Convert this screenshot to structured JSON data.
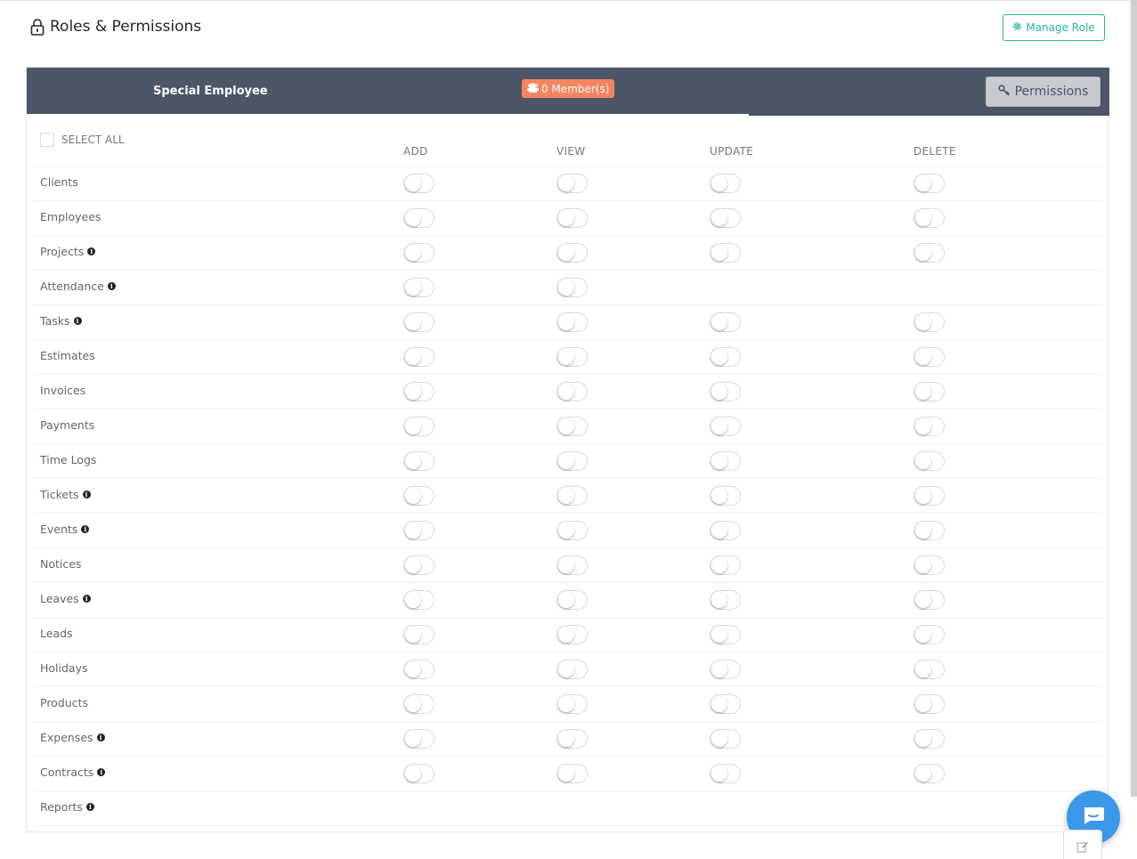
{
  "header": {
    "title": "Roles & Permissions",
    "manage_role_label": "Manage Role"
  },
  "role": {
    "name": "Special Employee",
    "members_label": "0 Member(s)",
    "permissions_button": "Permissions"
  },
  "table": {
    "select_all_label": "SELECT ALL",
    "columns": [
      "ADD",
      "VIEW",
      "UPDATE",
      "DELETE"
    ],
    "modules": [
      {
        "label": "Clients",
        "info": false,
        "toggles": [
          true,
          true,
          true,
          true
        ]
      },
      {
        "label": "Employees",
        "info": false,
        "toggles": [
          true,
          true,
          true,
          true
        ]
      },
      {
        "label": "Projects",
        "info": true,
        "toggles": [
          true,
          true,
          true,
          true
        ]
      },
      {
        "label": "Attendance",
        "info": true,
        "toggles": [
          true,
          true,
          false,
          false
        ]
      },
      {
        "label": "Tasks",
        "info": true,
        "toggles": [
          true,
          true,
          true,
          true
        ]
      },
      {
        "label": "Estimates",
        "info": false,
        "toggles": [
          true,
          true,
          true,
          true
        ]
      },
      {
        "label": "Invoices",
        "info": false,
        "toggles": [
          true,
          true,
          true,
          true
        ]
      },
      {
        "label": "Payments",
        "info": false,
        "toggles": [
          true,
          true,
          true,
          true
        ]
      },
      {
        "label": "Time Logs",
        "info": false,
        "toggles": [
          true,
          true,
          true,
          true
        ]
      },
      {
        "label": "Tickets",
        "info": true,
        "toggles": [
          true,
          true,
          true,
          true
        ]
      },
      {
        "label": "Events",
        "info": true,
        "toggles": [
          true,
          true,
          true,
          true
        ]
      },
      {
        "label": "Notices",
        "info": false,
        "toggles": [
          true,
          true,
          true,
          true
        ]
      },
      {
        "label": "Leaves",
        "info": true,
        "toggles": [
          true,
          true,
          true,
          true
        ]
      },
      {
        "label": "Leads",
        "info": false,
        "toggles": [
          true,
          true,
          true,
          true
        ]
      },
      {
        "label": "Holidays",
        "info": false,
        "toggles": [
          true,
          true,
          true,
          true
        ]
      },
      {
        "label": "Products",
        "info": false,
        "toggles": [
          true,
          true,
          true,
          true
        ]
      },
      {
        "label": "Expenses",
        "info": true,
        "toggles": [
          true,
          true,
          true,
          true
        ]
      },
      {
        "label": "Contracts",
        "info": true,
        "toggles": [
          true,
          true,
          true,
          true
        ]
      },
      {
        "label": "Reports",
        "info": true,
        "toggles": [
          false,
          false,
          false,
          false
        ]
      }
    ]
  },
  "colors": {
    "header_bg": "#4c5667",
    "accent_green": "#27b897",
    "badge_orange": "#f5845f",
    "chat_blue": "#3b97e8"
  }
}
